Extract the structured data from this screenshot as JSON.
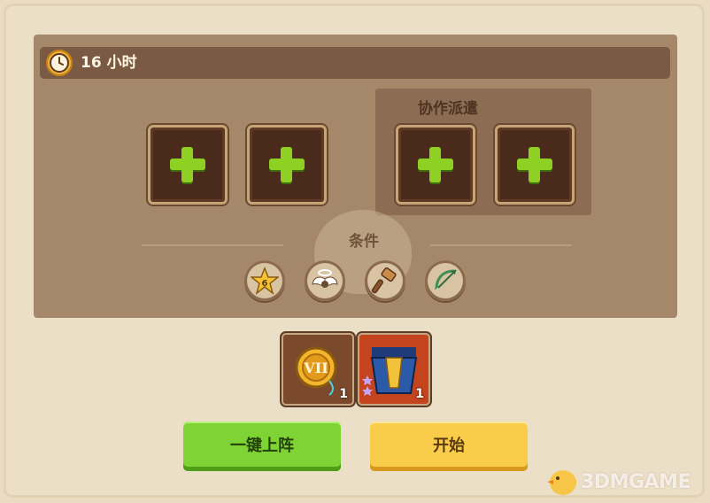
{
  "header": {
    "duration_label": "16 小时",
    "clock_icon": "clock-icon"
  },
  "slots": {
    "count": 4,
    "icon": "plus-icon"
  },
  "coop_dispatch": {
    "title": "协作派遣"
  },
  "conditions": {
    "label": "条件",
    "icons": [
      {
        "name": "star-rank-icon",
        "badge": "6"
      },
      {
        "name": "angel-wings-icon"
      },
      {
        "name": "hammer-icon"
      },
      {
        "name": "bow-icon"
      }
    ]
  },
  "rewards": [
    {
      "name": "gold-medal-vii-icon",
      "quantity": "1"
    },
    {
      "name": "hero-armor-card-icon",
      "quantity": "1"
    }
  ],
  "buttons": {
    "auto_deploy_label": "一键上阵",
    "start_label": "开始"
  },
  "colors": {
    "panel": "#a5876a",
    "header": "#7a5a42",
    "plus": "#8ed023",
    "green_button": "#7fd435",
    "yellow_button": "#f9cc4a"
  },
  "watermark": {
    "text": "3DMGAME"
  }
}
